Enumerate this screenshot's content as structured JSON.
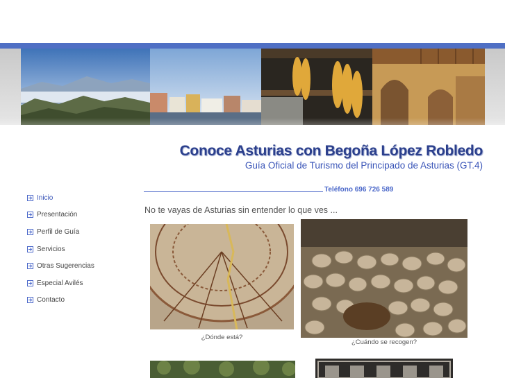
{
  "site": {
    "title": "Conoce Asturias con Begoña López Robledo",
    "subtitle": "Guía Oficial de Turismo del Principado de Asturias (GT.4)"
  },
  "nav": {
    "items": [
      {
        "label": "Inicio",
        "active": true
      },
      {
        "label": "Presentación"
      },
      {
        "label": "Perfil de Guía"
      },
      {
        "label": "Servicios"
      },
      {
        "label": "Otras Sugerencias"
      },
      {
        "label": "Especial Avilés"
      },
      {
        "label": "Contacto"
      }
    ]
  },
  "contact": {
    "phone_text": "Teléfono 696 726 589"
  },
  "main": {
    "intro": "No te vayas de Asturias sin entender lo que ves ...",
    "gallery": [
      {
        "caption": "¿Dónde está?",
        "icon": "carved-stone-photo"
      },
      {
        "caption": "¿Cuándo se recogen?",
        "icon": "potatoes-photo"
      },
      {
        "caption": "",
        "icon": "forest-photo"
      },
      {
        "caption": "",
        "icon": "carved-panel-photo"
      }
    ]
  },
  "colors": {
    "accent": "#4f6fc4",
    "title": "#2b3f8c",
    "link": "#3a55b8"
  }
}
